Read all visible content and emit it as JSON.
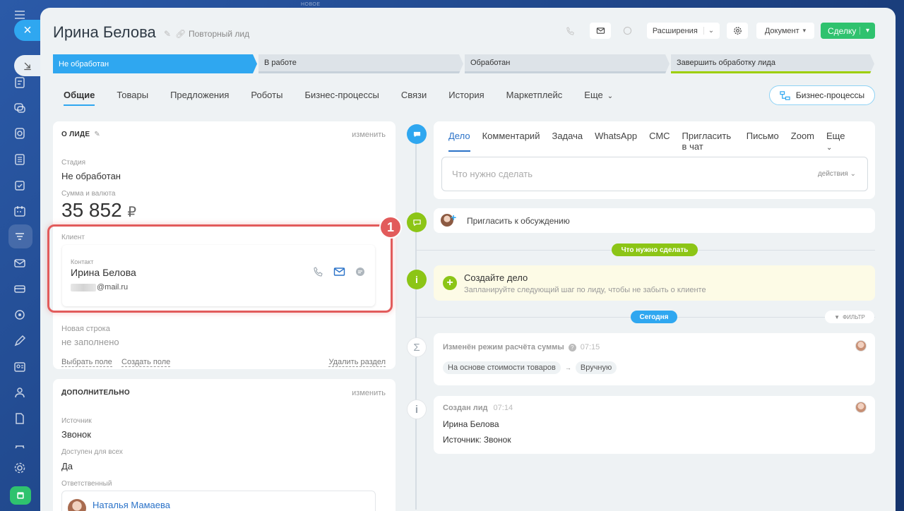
{
  "top_label": "НОВОЕ",
  "header": {
    "title": "Ирина Белова",
    "subtitle": "Повторный лид",
    "extensions_label": "Расширения",
    "document_label": "Документ",
    "deal_button": "Сделку"
  },
  "stages": [
    "Не обработан",
    "В работе",
    "Обработан",
    "Завершить обработку лида"
  ],
  "tabs": [
    "Общие",
    "Товары",
    "Предложения",
    "Роботы",
    "Бизнес-процессы",
    "Связи",
    "История",
    "Маркетплейс",
    "Еще"
  ],
  "bp_button": "Бизнес-процессы",
  "about": {
    "title": "О ЛИДЕ",
    "edit": "изменить",
    "stage_label": "Стадия",
    "stage_value": "Не обработан",
    "sum_label": "Сумма и валюта",
    "sum_value": "35 852",
    "currency": "₽",
    "client_label": "Клиент",
    "contact_label": "Контакт",
    "contact_name": "Ирина Белова",
    "contact_email": "@mail.ru",
    "new_row_label": "Новая строка",
    "new_row_value": "не заполнено",
    "choose_field": "Выбрать поле",
    "create_field": "Создать поле",
    "delete_section": "Удалить раздел"
  },
  "extra": {
    "title": "ДОПОЛНИТЕЛЬНО",
    "edit": "изменить",
    "source_label": "Источник",
    "source_value": "Звонок",
    "access_label": "Доступен для всех",
    "access_value": "Да",
    "responsible_label": "Ответственный",
    "responsible_value": "Наталья Мамаева"
  },
  "annotation_number": "1",
  "activity": {
    "tabs": [
      "Дело",
      "Комментарий",
      "Задача",
      "WhatsApp",
      "СМС",
      "Пригласить в чат",
      "Письмо",
      "Zoom",
      "Еще"
    ],
    "placeholder": "Что нужно сделать",
    "actions": "действия"
  },
  "invite": "Пригласить к обсуждению",
  "todo_pill": "Что нужно сделать",
  "create_task": {
    "title": "Создайте дело",
    "hint": "Запланируйте следующий шаг по лиду, чтобы не забыть о клиенте"
  },
  "today_pill": "Сегодня",
  "filter": "ФИЛЬТР",
  "history": [
    {
      "title": "Изменён режим расчёта суммы",
      "time": "07:15",
      "chip_from": "На основе стоимости товаров",
      "chip_to": "Вручную"
    },
    {
      "title": "Создан лид",
      "time": "07:14",
      "line1": "Ирина Белова",
      "line2": "Источник: Звонок"
    }
  ],
  "colors": {
    "accent": "#2fa7f0",
    "green": "#2fc26e",
    "lime": "#9dcf00",
    "highlight": "#e25b5b"
  }
}
